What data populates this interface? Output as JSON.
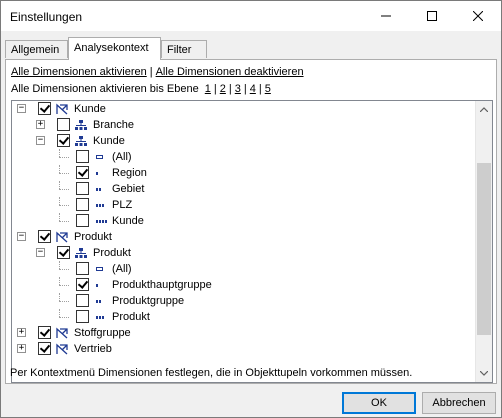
{
  "window": {
    "title": "Einstellungen",
    "minimize": "minimize-icon",
    "maximize": "maximize-icon",
    "close": "close-icon"
  },
  "tabs": [
    {
      "label": "Allgemein",
      "active": false
    },
    {
      "label": "Analysekontext",
      "active": true
    },
    {
      "label": "Filter",
      "active": false
    }
  ],
  "links": {
    "activate_all": "Alle Dimensionen aktivieren",
    "separator": "|",
    "deactivate_all": "Alle Dimensionen deaktivieren"
  },
  "levels": {
    "prefix": "Alle Dimensionen aktivieren bis Ebene",
    "values": [
      "1",
      "2",
      "3",
      "4",
      "5"
    ]
  },
  "tree": [
    {
      "label": "Kunde",
      "checked": true,
      "icon": "dimension-icon",
      "expander": "minus"
    },
    {
      "label": "Branche",
      "checked": false,
      "icon": "hierarchy-icon",
      "expander": "plus"
    },
    {
      "label": "Kunde",
      "checked": true,
      "icon": "hierarchy-icon",
      "expander": "minus"
    },
    {
      "label": "(All)",
      "checked": false,
      "icon": "level-all-icon",
      "expander": "none"
    },
    {
      "label": "Region",
      "checked": true,
      "icon": "level-1-icon",
      "expander": "none"
    },
    {
      "label": "Gebiet",
      "checked": false,
      "icon": "level-2-icon",
      "expander": "none"
    },
    {
      "label": "PLZ",
      "checked": false,
      "icon": "level-3-icon",
      "expander": "none"
    },
    {
      "label": "Kunde",
      "checked": false,
      "icon": "level-4-icon",
      "expander": "none"
    },
    {
      "label": "Produkt",
      "checked": true,
      "icon": "dimension-icon",
      "expander": "minus"
    },
    {
      "label": "Produkt",
      "checked": true,
      "icon": "hierarchy-icon",
      "expander": "minus"
    },
    {
      "label": "(All)",
      "checked": false,
      "icon": "level-all-icon",
      "expander": "none"
    },
    {
      "label": "Produkthauptgruppe",
      "checked": true,
      "icon": "level-1-icon",
      "expander": "none"
    },
    {
      "label": "Produktgruppe",
      "checked": false,
      "icon": "level-2-icon",
      "expander": "none"
    },
    {
      "label": "Produkt",
      "checked": false,
      "icon": "level-3-icon",
      "expander": "none"
    },
    {
      "label": "Stoffgruppe",
      "checked": true,
      "icon": "dimension-icon",
      "expander": "plus"
    },
    {
      "label": "Vertrieb",
      "checked": true,
      "icon": "dimension-icon",
      "expander": "plus"
    }
  ],
  "status_text": "Per Kontextmenü Dimensionen festlegen, die in Objekttupeln vorkommen müssen.",
  "buttons": {
    "ok": "OK",
    "cancel": "Abbrechen"
  },
  "colors": {
    "icon_blue": "#1f3a93",
    "accent": "#0078d7"
  }
}
